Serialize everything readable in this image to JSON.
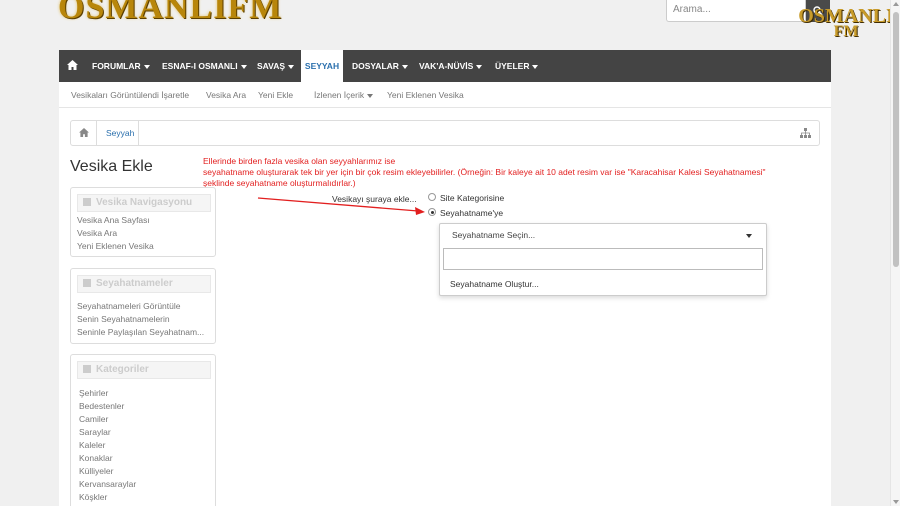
{
  "header": {
    "logo_text": "OSMANLIFM",
    "logo_small_line1": "OSMANLI",
    "logo_small_line2": "FM",
    "search_placeholder": "Arama..."
  },
  "nav": {
    "items": [
      {
        "label": "FORUMLAR",
        "dropdown": true
      },
      {
        "label": "ESNAF-I OSMANLI",
        "dropdown": true
      },
      {
        "label": "SAVAŞ",
        "dropdown": true
      },
      {
        "label": "SEYYAH",
        "dropdown": false,
        "active": true
      },
      {
        "label": "DOSYALAR",
        "dropdown": true
      },
      {
        "label": "VAK'A-NÜVİS",
        "dropdown": true
      },
      {
        "label": "ÜYELER",
        "dropdown": true
      }
    ]
  },
  "subnav": {
    "items": [
      "Vesikaları Görüntülendi İşaretle",
      "Vesika Ara",
      "Yeni Ekle",
      "İzlenen İçerik",
      "Yeni Eklenen Vesika"
    ]
  },
  "breadcrumb": {
    "items": [
      "Seyyah"
    ]
  },
  "page": {
    "title": "Vesika Ekle"
  },
  "annotation": {
    "line1": "Ellerinde birden fazla vesika olan seyyahlarımız ise",
    "line2": "seyahatname oluşturarak tek bir yer için bir çok resim ekleyebilirler. (Örneğin: Bir kaleye ait 10 adet resim var ise \"Karacahisar Kalesi Seyahatnamesi\"",
    "line3": "şeklinde seyahatname oluşturmalıdırlar.)",
    "color": "#e21f1f"
  },
  "sidebar": {
    "widgets": [
      {
        "title": "Vesika Navigasyonu",
        "links": [
          "Vesika Ana Sayfası",
          "Vesika Ara",
          "Yeni Eklenen Vesika"
        ]
      },
      {
        "title": "Seyahatnameler",
        "links": [
          "Seyahatnameleri Görüntüle",
          "Senin Seyahatnamelerin",
          "Seninle Paylaşılan Seyahatnam..."
        ]
      },
      {
        "title": "Kategoriler",
        "links": [
          "Şehirler",
          "Bedestenler",
          "Camiler",
          "Saraylar",
          "Kaleler",
          "Konaklar",
          "Külliyeler",
          "Kervansaraylar",
          "Köşkler"
        ]
      }
    ]
  },
  "form": {
    "label": "Vesikayı şuraya ekle...",
    "options": [
      {
        "label": "Site Kategorisine",
        "checked": false
      },
      {
        "label": "Seyahatname'ye",
        "checked": true
      }
    ],
    "dropdown": {
      "selected": "Seyahatname Seçin...",
      "search_value": "",
      "option": "Seyahatname Oluştur..."
    }
  },
  "colors": {
    "nav_bg": "#444444",
    "link": "#2a6fad",
    "accent_red": "#e21f1f"
  }
}
